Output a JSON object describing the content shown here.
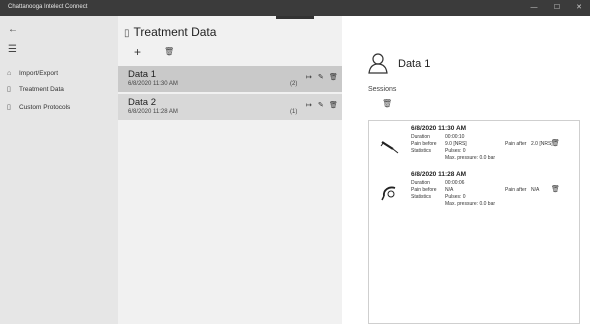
{
  "window": {
    "title": "Chattanooga Intelect Connect",
    "minimize_glyph": "—",
    "maximize_glyph": "☐",
    "close_glyph": "✕"
  },
  "nav": {
    "back_glyph": "←",
    "menu_glyph": "☰",
    "items": [
      {
        "label": "Import/Export",
        "icon": "home-icon",
        "glyph": "⌂"
      },
      {
        "label": "Treatment Data",
        "icon": "document-icon",
        "glyph": "▯"
      },
      {
        "label": "Custom Protocols",
        "icon": "document-icon",
        "glyph": "▯"
      }
    ]
  },
  "list": {
    "header_icon_glyph": "▯",
    "header": "Treatment Data",
    "add_glyph": "+",
    "delete_glyph": "🗑",
    "items": [
      {
        "name": "Data 1",
        "date": "6/8/2020 11:30 AM",
        "count": "(2)",
        "selected": true
      },
      {
        "name": "Data 2",
        "date": "6/8/2020 11:28 AM",
        "count": "(1)",
        "selected": false
      }
    ],
    "row_actions": {
      "expand": "↦",
      "edit": "✎",
      "delete": "🗑"
    }
  },
  "detail": {
    "title": "Data 1",
    "sessions_label": "Sessions",
    "delete_glyph": "🗑",
    "sessions": [
      {
        "date": "6/8/2020 11:30 AM",
        "duration_label": "Duration",
        "duration": "00:00:10",
        "pain_before_label": "Pain before",
        "pain_before": "9.0   [NRS]",
        "pain_after_label": "Pain after",
        "pain_after": "2.0   [NRS]",
        "statistics_label": "Statistics",
        "pulses": "Pulses: 0",
        "max_pressure": "Max. pressure: 0.0 bar",
        "icon": "applicator-icon"
      },
      {
        "date": "6/8/2020 11:28 AM",
        "duration_label": "Duration",
        "duration": "00:00:06",
        "pain_before_label": "Pain before",
        "pain_before": "N/A",
        "pain_after_label": "Pain after",
        "pain_after": "N/A",
        "statistics_label": "Statistics",
        "pulses": "Pulses: 0",
        "max_pressure": "Max. pressure: 0.0 bar",
        "icon": "handpiece-icon"
      }
    ]
  }
}
